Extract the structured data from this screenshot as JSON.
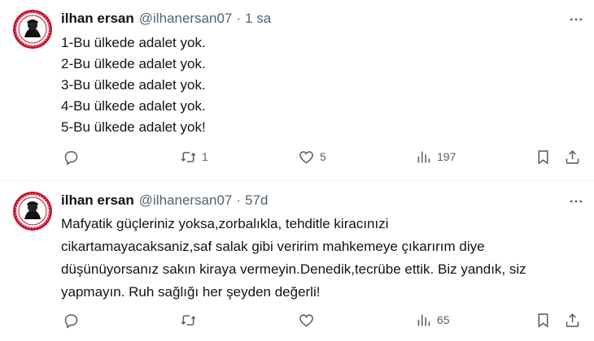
{
  "tweets": [
    {
      "name": "ilhan ersan",
      "handle": "@ilhanersan07",
      "dot": "·",
      "time": "1 sa",
      "lines": [
        "1-Bu ülkede adalet yok.",
        "2-Bu ülkede adalet yok.",
        "3-Bu ülkede adalet yok.",
        "4-Bu ülkede adalet yok.",
        "5-Bu ülkede adalet yok!"
      ],
      "replies": "",
      "retweets": "1",
      "likes": "5",
      "views": "197"
    },
    {
      "name": "ilhan ersan",
      "handle": "@ilhanersan07",
      "dot": "·",
      "time": "57d",
      "lines": [
        "Mafyatik güçleriniz yoksa,zorbalıkla, tehditle kiracınızi",
        "cikartamayacaksaniz,saf salak gibi veririm mahkemeye çıkarırım diye",
        "düşünüyorsanız sakın kiraya vermeyin.Denedik,tecrübe ettik. Biz yandık, siz",
        "yapmayın. Ruh sağlığı her şeyden değerli!"
      ],
      "replies": "",
      "retweets": "",
      "likes": "",
      "views": "65"
    }
  ],
  "icons": {
    "more": "more-horizontal-icon",
    "reply": "reply-icon",
    "retweet": "retweet-icon",
    "like": "heart-icon",
    "views": "views-icon",
    "bookmark": "bookmark-icon",
    "share": "share-icon"
  },
  "colors": {
    "avatar_ring": "#c8102e",
    "muted": "#536471",
    "divider": "#eff3f4"
  }
}
